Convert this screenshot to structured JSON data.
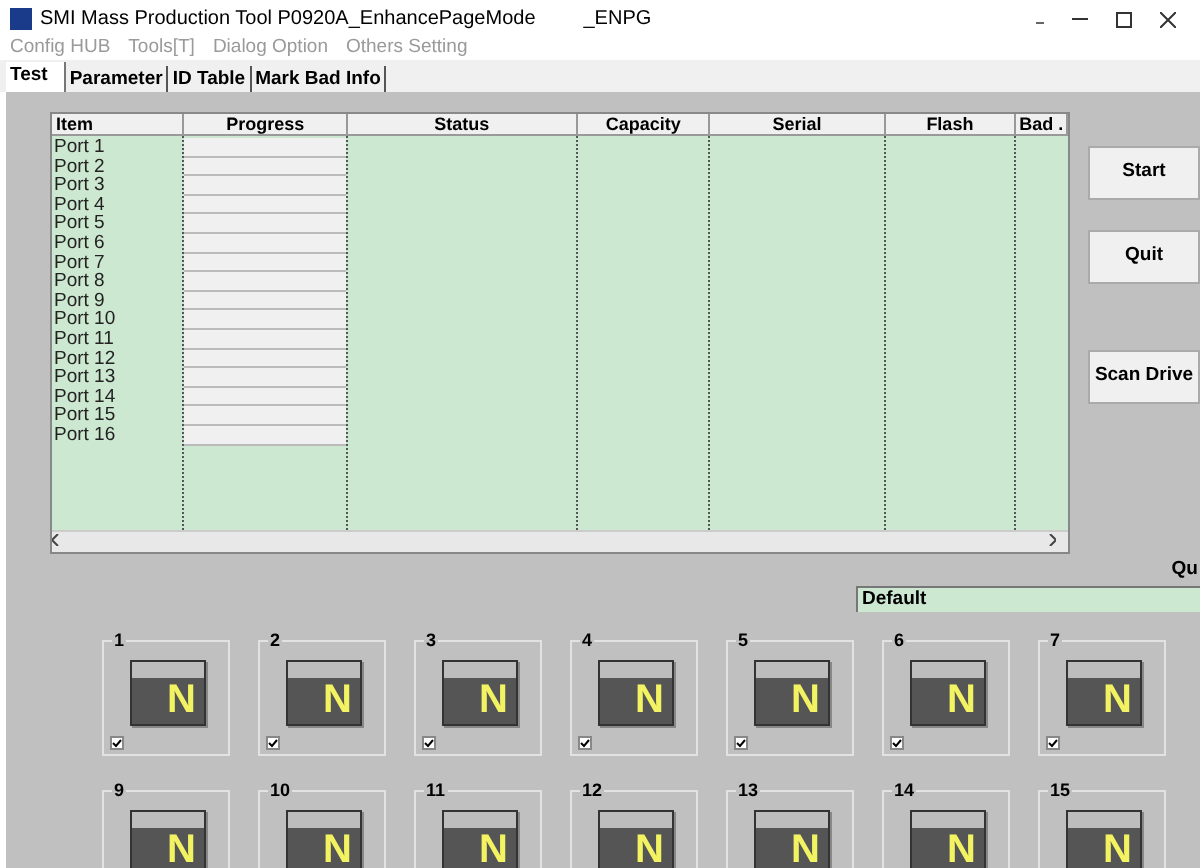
{
  "window": {
    "title": "SMI Mass Production Tool P0920A_EnhancePageMode",
    "title_suffix": "_ENPG"
  },
  "menu": [
    {
      "label": "Config HUB",
      "disabled": true
    },
    {
      "label": "Tools[T]",
      "disabled": true
    },
    {
      "label": "Dialog Option",
      "disabled": true
    },
    {
      "label": "Others Setting",
      "disabled": true
    }
  ],
  "tabs": [
    {
      "label": "Test",
      "selected": true
    },
    {
      "label": "Parameter",
      "selected": false
    },
    {
      "label": "ID Table",
      "selected": false
    },
    {
      "label": "Mark Bad Info",
      "selected": false
    }
  ],
  "table": {
    "columns": [
      "Item",
      "Progress",
      "Status",
      "Capacity",
      "Serial",
      "Flash",
      "Bad ."
    ],
    "rows": [
      {
        "item": "Port 1",
        "level": 0
      },
      {
        "item": "Port 2",
        "level": 0
      },
      {
        "item": "Port 3",
        "level": 0
      },
      {
        "item": "Port 4",
        "level": 0
      },
      {
        "item": "Port 5",
        "level": 0
      },
      {
        "item": "Port 6",
        "level": 0
      },
      {
        "item": "Port 7",
        "level": 0
      },
      {
        "item": "Port 8",
        "level": 0
      },
      {
        "item": "Port 9",
        "level": 0
      },
      {
        "item": "Port 10",
        "level": 0
      },
      {
        "item": "Port 11",
        "level": 0
      },
      {
        "item": "Port 12",
        "level": 0
      },
      {
        "item": "Port 13",
        "level": 0
      },
      {
        "item": "Port 14",
        "level": 0
      },
      {
        "item": "Port 15",
        "level": 0
      },
      {
        "item": "Port 16",
        "level": 0
      }
    ]
  },
  "buttons": [
    "Start",
    "Quit",
    "Scan Drive"
  ],
  "label_cut": "Qu",
  "setting_field": {
    "value": "Default"
  },
  "ports": [
    [
      {
        "label": "1",
        "letter": "N",
        "checked": true
      },
      {
        "label": "2",
        "letter": "N",
        "checked": true
      },
      {
        "label": "3",
        "letter": "N",
        "checked": true
      },
      {
        "label": "4",
        "letter": "N",
        "checked": true
      },
      {
        "label": "5",
        "letter": "N",
        "checked": true
      },
      {
        "label": "6",
        "letter": "N",
        "checked": true
      },
      {
        "label": "7",
        "letter": "N",
        "checked": true
      }
    ],
    [
      {
        "label": "9",
        "letter": "N"
      },
      {
        "label": "10",
        "letter": "N"
      },
      {
        "label": "11",
        "letter": "N"
      },
      {
        "label": "12",
        "letter": "N"
      },
      {
        "label": "13",
        "letter": "N"
      },
      {
        "label": "14",
        "letter": "N"
      },
      {
        "label": "15",
        "letter": "N"
      }
    ]
  ]
}
